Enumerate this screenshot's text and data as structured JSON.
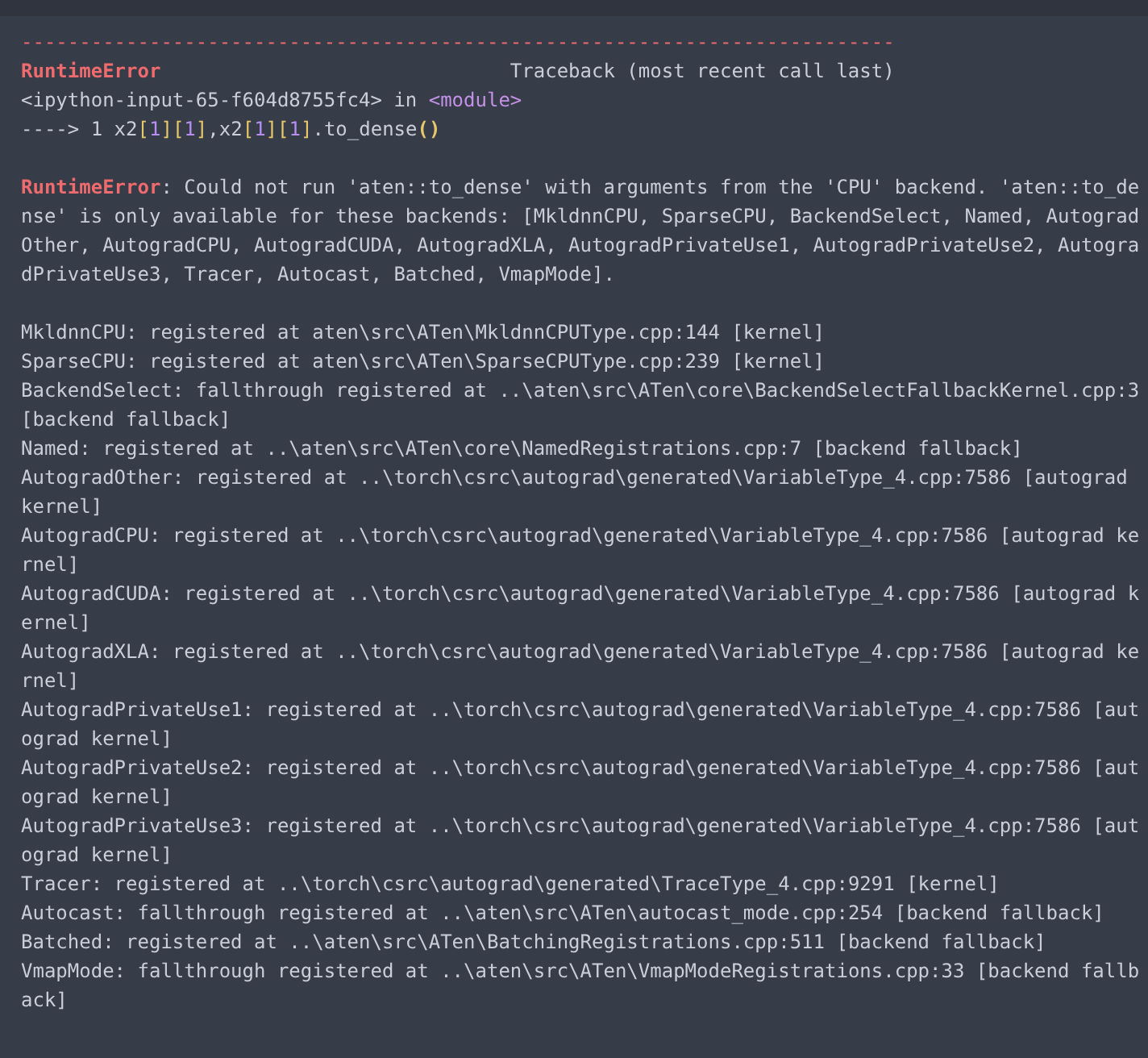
{
  "traceback": {
    "rule": "---------------------------------------------------------------------------",
    "error_name": "RuntimeError",
    "label": "Traceback (most recent call last)",
    "location": {
      "file": "<ipython-input-65-f604d8755fc4>",
      "word": "in",
      "module": "<module>"
    },
    "code_tokens": [
      {
        "kind": "plain",
        "text": "----> 1 x2"
      },
      {
        "kind": "bracket",
        "text": "["
      },
      {
        "kind": "number",
        "text": "1"
      },
      {
        "kind": "bracket",
        "text": "]["
      },
      {
        "kind": "number",
        "text": "1"
      },
      {
        "kind": "bracket",
        "text": "]"
      },
      {
        "kind": "plain",
        "text": ",x2"
      },
      {
        "kind": "bracket",
        "text": "["
      },
      {
        "kind": "number",
        "text": "1"
      },
      {
        "kind": "bracket",
        "text": "]["
      },
      {
        "kind": "number",
        "text": "1"
      },
      {
        "kind": "bracket",
        "text": "]"
      },
      {
        "kind": "plain",
        "text": ".to_dense"
      },
      {
        "kind": "paren",
        "text": "()"
      }
    ]
  },
  "error": {
    "name": "RuntimeError",
    "message": ": Could not run 'aten::to_dense' with arguments from the 'CPU' backend. 'aten::to_dense' is only available for these backends: [MkldnnCPU, SparseCPU, BackendSelect, Named, AutogradOther, AutogradCPU, AutogradCUDA, AutogradXLA, AutogradPrivateUse1, AutogradPrivateUse2, AutogradPrivateUse3, Tracer, Autocast, Batched, VmapMode]."
  },
  "registrations": [
    "MkldnnCPU: registered at aten\\src\\ATen\\MkldnnCPUType.cpp:144 [kernel]",
    "SparseCPU: registered at aten\\src\\ATen\\SparseCPUType.cpp:239 [kernel]",
    "BackendSelect: fallthrough registered at ..\\aten\\src\\ATen\\core\\BackendSelectFallbackKernel.cpp:3 [backend fallback]",
    "Named: registered at ..\\aten\\src\\ATen\\core\\NamedRegistrations.cpp:7 [backend fallback]",
    "AutogradOther: registered at ..\\torch\\csrc\\autograd\\generated\\VariableType_4.cpp:7586 [autograd kernel]",
    "AutogradCPU: registered at ..\\torch\\csrc\\autograd\\generated\\VariableType_4.cpp:7586 [autograd kernel]",
    "AutogradCUDA: registered at ..\\torch\\csrc\\autograd\\generated\\VariableType_4.cpp:7586 [autograd kernel]",
    "AutogradXLA: registered at ..\\torch\\csrc\\autograd\\generated\\VariableType_4.cpp:7586 [autograd kernel]",
    "AutogradPrivateUse1: registered at ..\\torch\\csrc\\autograd\\generated\\VariableType_4.cpp:7586 [autograd kernel]",
    "AutogradPrivateUse2: registered at ..\\torch\\csrc\\autograd\\generated\\VariableType_4.cpp:7586 [autograd kernel]",
    "AutogradPrivateUse3: registered at ..\\torch\\csrc\\autograd\\generated\\VariableType_4.cpp:7586 [autograd kernel]",
    "Tracer: registered at ..\\torch\\csrc\\autograd\\generated\\TraceType_4.cpp:9291 [kernel]",
    "Autocast: fallthrough registered at ..\\aten\\src\\ATen\\autocast_mode.cpp:254 [backend fallback]",
    "Batched: registered at ..\\aten\\src\\ATen\\BatchingRegistrations.cpp:511 [backend fallback]",
    "VmapMode: fallthrough registered at ..\\aten\\src\\ATen\\VmapModeRegistrations.cpp:33 [backend fallback]"
  ]
}
